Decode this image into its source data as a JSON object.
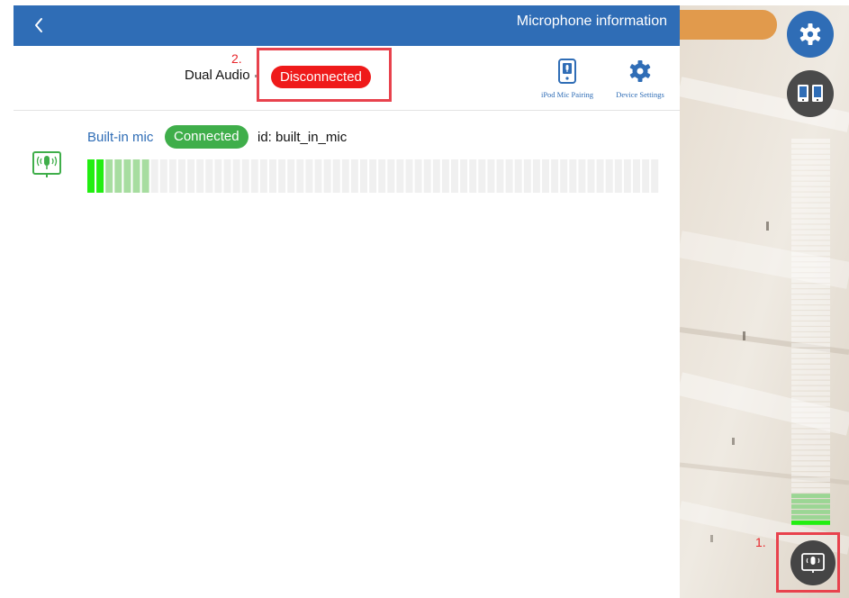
{
  "header": {
    "title": "Microphone information"
  },
  "status": {
    "dual_label": "Dual Audio",
    "dual_status": "Disconnected",
    "disconnected_color": "#ef1a1a"
  },
  "toolbar": {
    "ipod_pairing_label": "iPod Mic Pairing",
    "device_settings_label": "Device Settings"
  },
  "mic": {
    "name": "Built-in mic",
    "status": "Connected",
    "id_text": "id: built_in_mic",
    "connected_color": "#3fae4a",
    "level_meter": {
      "total_segments": 63,
      "active_segments": 2,
      "recent_peak_segments": 7
    }
  },
  "camera_overlay": {
    "vu_meter": {
      "total_segments": 72,
      "active_segments": 1,
      "recent_peak_segments": 6
    },
    "icons": [
      "gear-icon",
      "dual-pair-icon",
      "mic-source-icon"
    ]
  },
  "annotations": [
    {
      "label": "1.",
      "target": "mic-source-button"
    },
    {
      "label": "2.",
      "target": "dual-audio-status"
    }
  ],
  "colors": {
    "nav_blue": "#2f6db6",
    "annotation_red": "#e8424d",
    "meter_green": "#22ee11",
    "meter_light_green": "#a7dda0",
    "meter_inactive": "#f0f0f0"
  }
}
